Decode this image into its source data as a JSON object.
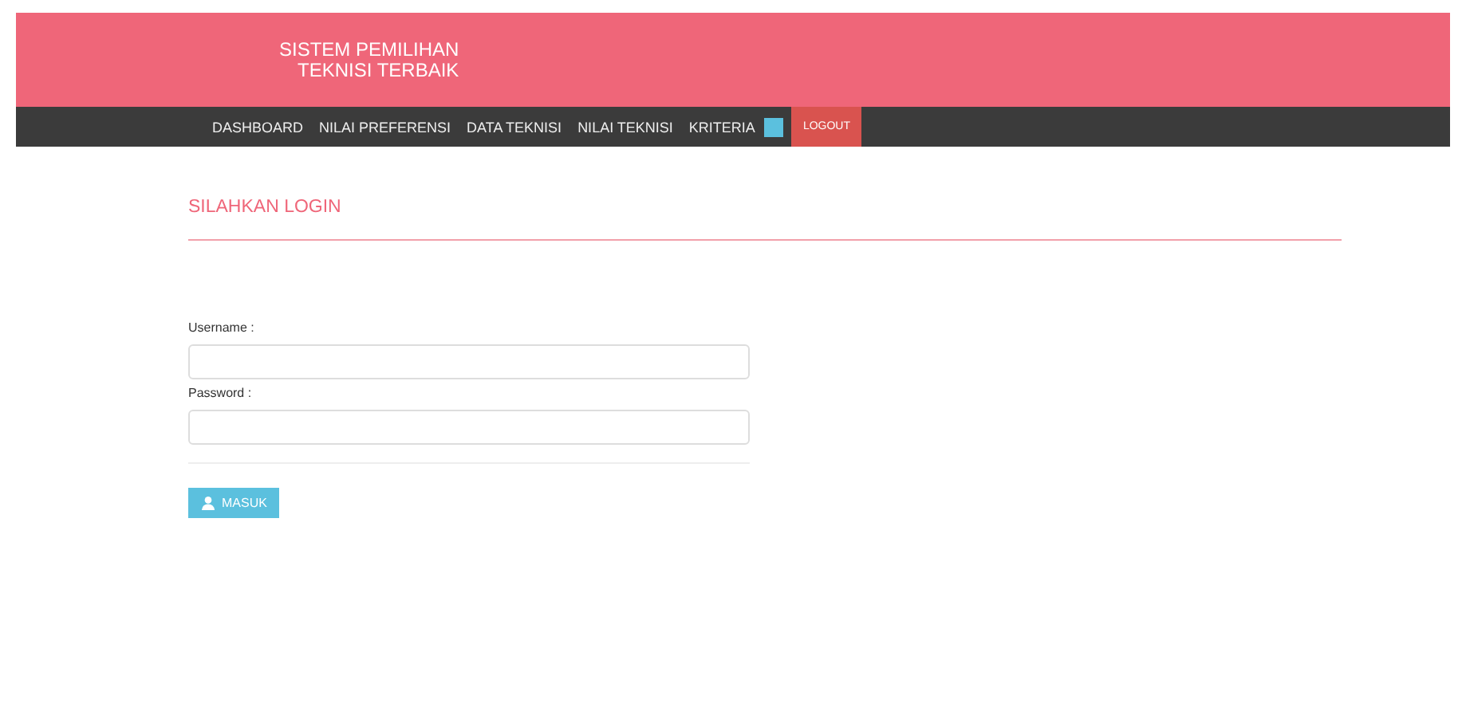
{
  "header": {
    "title_lines": [
      "SISTEM PEMILIHAN",
      "TEKNISI TERBAIK"
    ]
  },
  "nav": {
    "items": [
      {
        "label": "DASHBOARD",
        "kind": "link"
      },
      {
        "label": "NILAI PREFERENSI",
        "kind": "link"
      },
      {
        "label": "DATA TEKNISI",
        "kind": "link"
      },
      {
        "label": "NILAI TEKNISI",
        "kind": "link"
      },
      {
        "label": "KRITERIA",
        "kind": "link"
      },
      {
        "kind": "swatch"
      },
      {
        "label": "LOGOUT",
        "kind": "button"
      }
    ]
  },
  "login": {
    "heading": "SILAHKAN LOGIN",
    "fields": [
      {
        "label": "Username :"
      },
      {
        "label": "Password :"
      }
    ],
    "submit": "MASUK"
  }
}
